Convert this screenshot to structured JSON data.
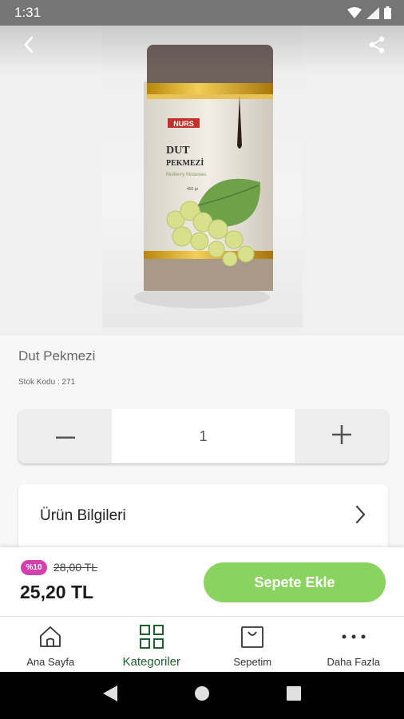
{
  "status_bar": {
    "time": "1:31"
  },
  "product": {
    "name": "Dut Pekmezi",
    "stock_label": "Stok Kodu : ",
    "stock_code": "271",
    "image": {
      "brand": "NURS",
      "title_line1": "DUT",
      "title_line2": "PEKMEZİ",
      "subtitle": "Mulberry Molasses",
      "weight": "450 gr"
    }
  },
  "quantity": {
    "value": "1"
  },
  "info_section": {
    "label": "Ürün Bilgileri"
  },
  "price_bar": {
    "discount_badge": "%10",
    "old_price": "28,00 TL",
    "current_price": "25,20 TL",
    "add_to_cart_label": "Sepete Ekle"
  },
  "bottom_nav": {
    "items": [
      {
        "label": "Ana Sayfa",
        "icon": "home-icon"
      },
      {
        "label": "Kategoriler",
        "icon": "grid-icon"
      },
      {
        "label": "Sepetim",
        "icon": "bag-icon"
      },
      {
        "label": "Daha Fazla",
        "icon": "more-icon"
      }
    ],
    "active_index": 1
  },
  "colors": {
    "accent_green": "#8bd361",
    "active_nav_green": "#1f5f2e",
    "discount_pink": "#d63fae"
  }
}
